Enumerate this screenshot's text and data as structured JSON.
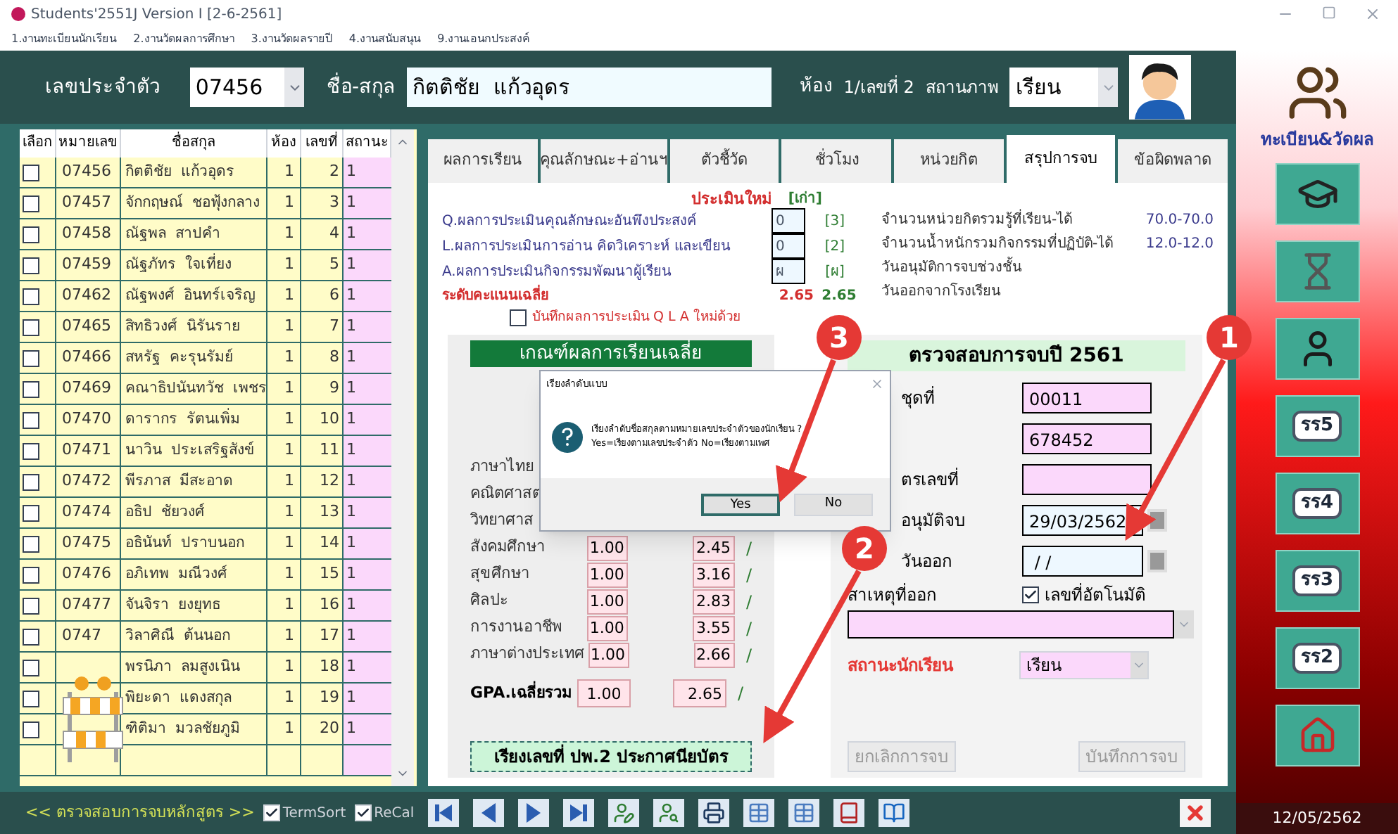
{
  "window": {
    "title": "Students'2551J Version I [2-6-2561]"
  },
  "menu": [
    "1.งานทะเบียนนักเรียน",
    "2.งานวัดผลการศึกษา",
    "3.งานวัดผลรายปี",
    "4.งานสนับสนุน",
    "9.งานเอนกประสงค์"
  ],
  "header": {
    "id_label": "เลขประจำตัว",
    "id_value": "07456",
    "name_label": "ชื่อ-สกุล",
    "name_value": "กิตติชัย  แก้วอุดร",
    "room_label": "ห้อง",
    "room_value": "1/เลขที่ 2",
    "status_label": "สถานภาพ",
    "status_value": "เรียน"
  },
  "table": {
    "columns": [
      "เลือก",
      "หมายเลข",
      "ชื่อสกุล",
      "ห้อง",
      "เลขที่",
      "สถานะ"
    ],
    "rows": [
      {
        "checked": false,
        "id": "07456",
        "name": "กิตติชัย  แก้วอุดร",
        "room": "1",
        "no": "2",
        "status": "1"
      },
      {
        "checked": false,
        "id": "07457",
        "name": "จักกฤษณ์  ชอฟุ้งกลาง",
        "room": "1",
        "no": "3",
        "status": "1"
      },
      {
        "checked": false,
        "id": "07458",
        "name": "ณัฐพล  สาปคำ",
        "room": "1",
        "no": "4",
        "status": "1"
      },
      {
        "checked": false,
        "id": "07459",
        "name": "ณัฐภัทร  ใจเที่ยง",
        "room": "1",
        "no": "5",
        "status": "1"
      },
      {
        "checked": false,
        "id": "07462",
        "name": "ณัฐพงศ์  อินทร์เจริญ",
        "room": "1",
        "no": "6",
        "status": "1"
      },
      {
        "checked": false,
        "id": "07465",
        "name": "สิทธิวงศ์  นิรันราย",
        "room": "1",
        "no": "7",
        "status": "1"
      },
      {
        "checked": false,
        "id": "07466",
        "name": "สหรัฐ  คะรุนรัมย์",
        "room": "1",
        "no": "8",
        "status": "1"
      },
      {
        "checked": false,
        "id": "07469",
        "name": "คณาธิปนันทวัช  เพชร",
        "room": "1",
        "no": "9",
        "status": "1"
      },
      {
        "checked": false,
        "id": "07470",
        "name": "ดารากร  รัตนเพิ่ม",
        "room": "1",
        "no": "10",
        "status": "1"
      },
      {
        "checked": false,
        "id": "07471",
        "name": "นาวิน  ประเสริฐสังข์",
        "room": "1",
        "no": "11",
        "status": "1"
      },
      {
        "checked": false,
        "id": "07472",
        "name": "พีรภาส  มีสะอาด",
        "room": "1",
        "no": "12",
        "status": "1"
      },
      {
        "checked": false,
        "id": "07474",
        "name": "อธิป  ชัยวงศ์",
        "room": "1",
        "no": "13",
        "status": "1"
      },
      {
        "checked": false,
        "id": "07475",
        "name": "อธินันท์  ปราบนอก",
        "room": "1",
        "no": "14",
        "status": "1"
      },
      {
        "checked": false,
        "id": "07476",
        "name": "อภิเทพ  มณีวงศ์",
        "room": "1",
        "no": "15",
        "status": "1"
      },
      {
        "checked": false,
        "id": "07477",
        "name": "จันจิรา  ยงยุทธ",
        "room": "1",
        "no": "16",
        "status": "1"
      },
      {
        "checked": false,
        "id": "0747",
        "name": "วิลาศิณี  ต้นนอก",
        "room": "1",
        "no": "17",
        "status": "1"
      },
      {
        "checked": false,
        "name": "พรนิภา  ลมสูงเนิน",
        "room": "1",
        "no": "18",
        "status": "1"
      },
      {
        "checked": false,
        "name": "พิยะดา  แดงสกุล",
        "room": "1",
        "no": "19",
        "status": "1"
      },
      {
        "checked": false,
        "name": "ฑิติมา  มวลชัยภูมิ",
        "room": "1",
        "no": "20",
        "status": "1"
      }
    ]
  },
  "tabs": [
    {
      "label": "ผลการเรียน",
      "selected": false
    },
    {
      "label": "คุณลักษณะ+อ่านฯ",
      "selected": false
    },
    {
      "label": "ตัวชี้วัด",
      "selected": false
    },
    {
      "label": "ชั่วโมง",
      "selected": false
    },
    {
      "label": "หน่วยกิต",
      "selected": false
    },
    {
      "label": "สรุปการจบ",
      "selected": true
    },
    {
      "label": "ข้อผิดพลาด",
      "selected": false
    }
  ],
  "assessment": {
    "new_label": "ประเมินใหม่",
    "old_label": "[เก่า]",
    "rows": [
      {
        "label": "Q.ผลการประเมินคุณลักษณะอันพึงประสงค์",
        "new": "0",
        "old": "[3]"
      },
      {
        "label": "L.ผลการประเมินการอ่าน คิดวิเคราะห์ และเขียน",
        "new": "0",
        "old": "[2]"
      },
      {
        "label": "A.ผลการประเมินกิจกรรมพัฒนาผู้เรียน",
        "new": "ผ",
        "old": "[ผ]"
      }
    ],
    "average": {
      "label": "ระดับคะแนนเฉลี่ย",
      "new": "2.65",
      "old": "2.65"
    },
    "info": [
      {
        "label": "จำนวนหน่วยกิตรวมรู้ที่เรียน-ได้",
        "value": "70.0-70.0"
      },
      {
        "label": "จำนวนน้ำหนักรวมกิจกรรมที่ปฏิบัติ-ได้",
        "value": "12.0-12.0"
      },
      {
        "label": "วันอนุมัติการจบช่วงชั้น"
      },
      {
        "label": "วันออกจากโรงเรียน"
      }
    ],
    "save_option": {
      "label": "บันทึกผลการประเมิน Q L A ใหม่ด้วย",
      "checked": false
    }
  },
  "criteria": {
    "title": "เกณฑ์ผลการเรียนเฉลี่ย",
    "subjects": [
      {
        "label": "ภาษาไทย"
      },
      {
        "label": "คณิตศาสต"
      },
      {
        "label": "วิทยาศาส"
      },
      {
        "label": "สังคมศึกษา",
        "min": "1.00",
        "value": "2.45",
        "mark": "/"
      },
      {
        "label": "สุขศึกษา",
        "min": "1.00",
        "value": "3.16",
        "mark": "/"
      },
      {
        "label": "ศิลปะ",
        "min": "1.00",
        "value": "2.83",
        "mark": "/"
      },
      {
        "label": "การงานอาชีพ",
        "min": "1.00",
        "value": "3.55",
        "mark": "/"
      },
      {
        "label": "ภาษาต่างประเทศ",
        "min": "1.00",
        "value": "2.66",
        "mark": "/"
      }
    ],
    "gpa": {
      "label": "GPA.เฉลี่ยรวม",
      "min": "1.00",
      "value": "2.65",
      "mark": "/"
    },
    "button": "เรียงเลขที่ ปพ.2 ประกาศนียบัตร"
  },
  "graduation": {
    "title": "ตรวจสอบการจบปี 2561",
    "fields": [
      {
        "label": "ชุดที่",
        "value": "00011",
        "kind": "text"
      },
      {
        "value": "678452",
        "kind": "text"
      },
      {
        "label": "ตรเลขที่",
        "kind": "text"
      },
      {
        "label": "อนุมัติจบ",
        "value": "29/03/2562",
        "kind": "date"
      },
      {
        "label": "วันออก",
        "value": " / /",
        "kind": "date"
      }
    ],
    "reason_label": "สาเหตุที่ออก",
    "auto_number": {
      "label": "เลขที่อัตโนมัติ",
      "checked": true
    },
    "status_label": "สถานะนักเรียน",
    "status_value": "เรียน",
    "buttons": [
      {
        "label": "ยกเลิกการจบ",
        "disabled": true
      },
      {
        "label": "บันทึกการจบ",
        "disabled": true
      }
    ]
  },
  "dialog": {
    "title": "เรียงลำดับแบบ",
    "message": [
      "เรียงลำดับชื่อสกุลตามหมายเลขประจำตัวของนักเรียน ?",
      "Yes=เรียงตามเลขประจำตัว No=เรียงตามเพศ"
    ],
    "buttons": [
      {
        "label": "Yes",
        "selected": true
      },
      {
        "label": "No",
        "selected": false
      }
    ]
  },
  "annotations": [
    "1",
    "2",
    "3"
  ],
  "bottom_bar": {
    "caption": "<< ตรวจสอบการจบหลักสูตร >>",
    "options": [
      {
        "label": "TermSort",
        "checked": true
      },
      {
        "label": "ReCal",
        "checked": true
      }
    ]
  },
  "sidebar": {
    "caption": "ทะเบียน&วัดผล",
    "items": [
      {
        "kind": "graduate"
      },
      {
        "kind": "hourglass"
      },
      {
        "kind": "student"
      },
      {
        "kind": "label",
        "label": "รร5"
      },
      {
        "kind": "label",
        "label": "รร4"
      },
      {
        "kind": "label",
        "label": "รร3"
      },
      {
        "kind": "label",
        "label": "รร2"
      },
      {
        "kind": "home"
      }
    ],
    "date": "12/05/2562"
  }
}
